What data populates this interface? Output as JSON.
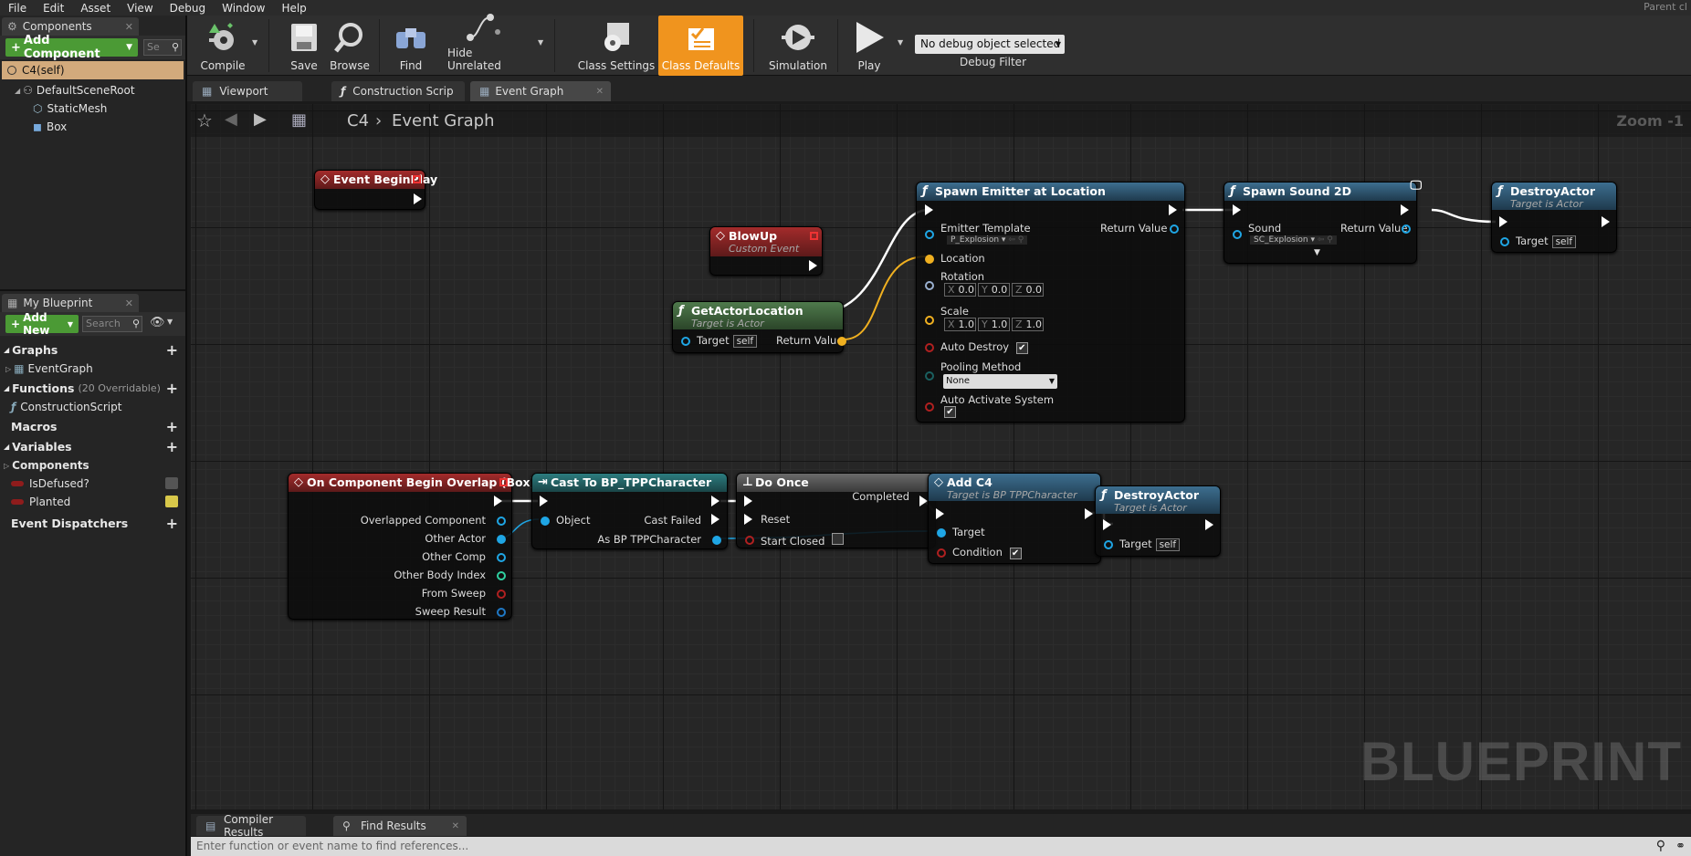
{
  "menu": [
    "File",
    "Edit",
    "Asset",
    "View",
    "Debug",
    "Window",
    "Help"
  ],
  "parent_class": "Parent cl",
  "components_panel": {
    "tab": "Components",
    "add_component": "Add Component",
    "search_placeholder": "Se",
    "self_item": "C4(self)",
    "tree": [
      "DefaultSceneRoot",
      "StaticMesh",
      "Box"
    ]
  },
  "my_blueprint": {
    "tab": "My Blueprint",
    "add_new": "Add New",
    "search_placeholder": "Search",
    "graphs": "Graphs",
    "event_graph": "EventGraph",
    "functions": "Functions",
    "functions_note": "(20 Overridable)",
    "construction_script": "ConstructionScript",
    "macros": "Macros",
    "variables": "Variables",
    "components_cat": "Components",
    "vars": [
      "IsDefused?",
      "Planted"
    ],
    "event_dispatchers": "Event Dispatchers"
  },
  "toolbar": {
    "compile": "Compile",
    "save": "Save",
    "browse": "Browse",
    "find": "Find",
    "hide_unrelated": "Hide Unrelated",
    "class_settings": "Class Settings",
    "class_defaults": "Class Defaults",
    "simulation": "Simulation",
    "play": "Play",
    "debug_object": "No debug object selected",
    "debug_filter": "Debug Filter"
  },
  "doc_tabs": [
    "Viewport",
    "Construction Scrip",
    "Event Graph"
  ],
  "graph": {
    "breadcrumb_root": "C4",
    "breadcrumb_current": "Event Graph",
    "zoom": "Zoom -1",
    "watermark": "BLUEPRINT"
  },
  "nodes": {
    "begin_play": {
      "title": "Event BeginPlay"
    },
    "blowup": {
      "title": "BlowUp",
      "sub": "Custom Event"
    },
    "get_actor_location": {
      "title": "GetActorLocation",
      "sub": "Target is Actor",
      "target": "Target",
      "self": "self",
      "ret": "Return Value"
    },
    "spawn_emitter": {
      "title": "Spawn Emitter at Location",
      "emitter_template": "Emitter Template",
      "emitter_value": "P_Explosion",
      "return_value": "Return Value",
      "location": "Location",
      "rotation": "Rotation",
      "rot": [
        "0.0",
        "0.0",
        "0.0"
      ],
      "scale": "Scale",
      "scl": [
        "1.0",
        "1.0",
        "1.0"
      ],
      "auto_destroy": "Auto Destroy",
      "pooling_method": "Pooling Method",
      "pooling_value": "None",
      "auto_activate": "Auto Activate System"
    },
    "spawn_sound": {
      "title": "Spawn Sound 2D",
      "sound": "Sound",
      "sound_value": "SC_Explosion",
      "ret": "Return Value"
    },
    "destroy_actor_1": {
      "title": "DestroyActor",
      "sub": "Target is Actor",
      "target": "Target",
      "self": "self"
    },
    "overlap": {
      "title": "On Component Begin Overlap (Box)",
      "pins": [
        "Overlapped Component",
        "Other Actor",
        "Other Comp",
        "Other Body Index",
        "From Sweep",
        "Sweep Result"
      ]
    },
    "cast": {
      "title": "Cast To BP_TPPCharacter",
      "object": "Object",
      "cast_failed": "Cast Failed",
      "as": "As BP TPPCharacter"
    },
    "do_once": {
      "title": "Do Once",
      "completed": "Completed",
      "reset": "Reset",
      "start_closed": "Start Closed"
    },
    "add_c4": {
      "title": "Add C4",
      "sub": "Target is BP TPPCharacter",
      "target": "Target",
      "condition": "Condition"
    },
    "destroy_actor_2": {
      "title": "DestroyActor",
      "sub": "Target is Actor",
      "target": "Target",
      "self": "self"
    }
  },
  "bottom": {
    "tabs": [
      "Compiler Results",
      "Find Results"
    ],
    "find_placeholder": "Enter function or event name to find references..."
  }
}
